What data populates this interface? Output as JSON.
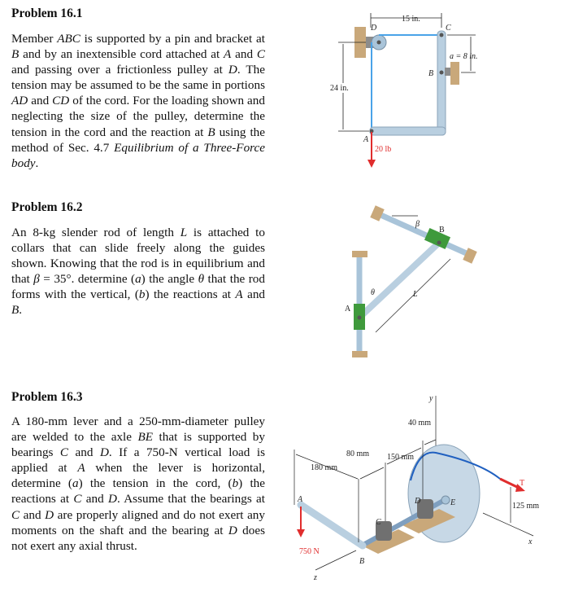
{
  "problems": [
    {
      "title": "Problem 16.1",
      "text_parts": [
        {
          "t": "Member "
        },
        {
          "i": "ABC"
        },
        {
          "t": " is supported by a pin and bracket at "
        },
        {
          "i": "B"
        },
        {
          "t": " and by an inextensible cord attached at "
        },
        {
          "i": "A"
        },
        {
          "t": " and "
        },
        {
          "i": "C"
        },
        {
          "t": " and passing over a frictionless pulley at "
        },
        {
          "i": "D"
        },
        {
          "t": ". The tension may be assumed to be the same in portions "
        },
        {
          "i": "AD"
        },
        {
          "t": " and "
        },
        {
          "i": "CD"
        },
        {
          "t": " of the cord. For the loading shown and neglecting the size of the pulley, determine the tension in the cord and the reaction at "
        },
        {
          "i": "B"
        },
        {
          "t": " using the method of Sec. 4.7 "
        },
        {
          "i": "Equilibrium of a Three-Force body"
        },
        {
          "t": "."
        }
      ],
      "figure": {
        "dim_horizontal": "15 in.",
        "dim_vertical": "24 in.",
        "dim_a": "a = 8 in.",
        "load": "20 lb",
        "points": {
          "A": "A",
          "B": "B",
          "C": "C",
          "D": "D"
        }
      }
    },
    {
      "title": "Problem 16.2",
      "text_parts": [
        {
          "t": "An 8-kg slender rod of length "
        },
        {
          "i": "L"
        },
        {
          "t": " is attached to collars that can slide freely along the guides shown. Knowing that the rod is in equilibrium and that "
        },
        {
          "i": "β"
        },
        {
          "t": " = 35°.  determine ("
        },
        {
          "i": "a"
        },
        {
          "t": ") the angle "
        },
        {
          "i": "θ"
        },
        {
          "t": " that the rod forms with the vertical, ("
        },
        {
          "i": "b"
        },
        {
          "t": ") the reactions at "
        },
        {
          "i": "A"
        },
        {
          "t": " and "
        },
        {
          "i": "B"
        },
        {
          "t": "."
        }
      ],
      "figure": {
        "beta": "β",
        "theta": "θ",
        "length": "L",
        "points": {
          "A": "A",
          "B": "B"
        }
      }
    },
    {
      "title": "Problem 16.3",
      "text_parts": [
        {
          "t": "A 180-mm lever and a 250-mm-diameter pulley are welded to the axle "
        },
        {
          "i": "BE"
        },
        {
          "t": " that is supported by bearings "
        },
        {
          "i": "C"
        },
        {
          "t": " and "
        },
        {
          "i": "D"
        },
        {
          "t": ".  If a 750-N vertical load is applied at "
        },
        {
          "i": "A"
        },
        {
          "t": " when the lever is horizontal, determine ("
        },
        {
          "i": "a"
        },
        {
          "t": ") the tension in the cord, ("
        },
        {
          "i": "b"
        },
        {
          "t": ") the reactions at "
        },
        {
          "i": "C"
        },
        {
          "t": " and "
        },
        {
          "i": "D"
        },
        {
          "t": ".  Assume that the bearings at "
        },
        {
          "i": "C"
        },
        {
          "t": " and "
        },
        {
          "i": "D"
        },
        {
          "t": " are properly aligned and do not exert any moments on the shaft and the bearing at "
        },
        {
          "i": "D"
        },
        {
          "t": " does not exert any axial thrust."
        }
      ],
      "figure": {
        "dim_lever": "180 mm",
        "dim_bc": "80 mm",
        "dim_cd": "150 mm",
        "dim_de": "40 mm",
        "dim_radius": "125 mm",
        "load": "750 N",
        "tension": "T",
        "axes": {
          "x": "x",
          "y": "y",
          "z": "z"
        },
        "points": {
          "A": "A",
          "B": "B",
          "C": "C",
          "D": "D",
          "E": "E"
        }
      }
    }
  ],
  "colors": {
    "cord": "#4aa3e8",
    "load_arrow": "#e02d2d",
    "member": "#b9cfe0",
    "wall": "#c9a87a",
    "collar": "#3f9a3c"
  }
}
